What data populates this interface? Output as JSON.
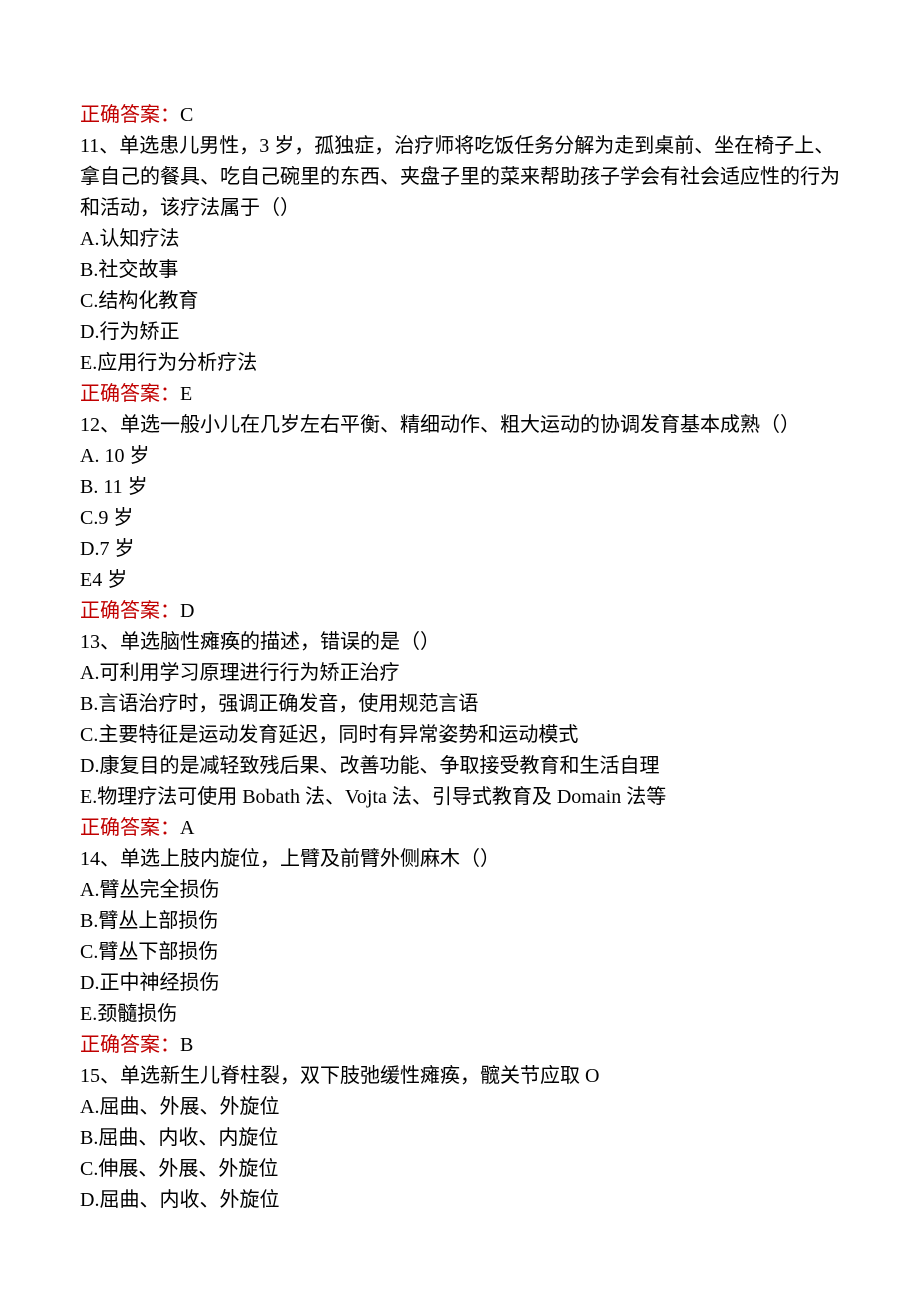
{
  "answer10": {
    "label": "正确答案：",
    "value": "C"
  },
  "q11": {
    "stem": "11、单选患儿男性，3 岁，孤独症，治疗师将吃饭任务分解为走到桌前、坐在椅子上、拿自己的餐具、吃自己碗里的东西、夹盘子里的菜来帮助孩子学会有社会适应性的行为和活动，该疗法属于（）",
    "optA": "A.认知疗法",
    "optB": "B.社交故事",
    "optC": "C.结构化教育",
    "optD": "D.行为矫正",
    "optE": "E.应用行为分析疗法",
    "answerLabel": "正确答案：",
    "answerValue": "E"
  },
  "q12": {
    "stem": "12、单选一般小儿在几岁左右平衡、精细动作、粗大运动的协调发育基本成熟（）",
    "optA": "A. 10 岁",
    "optB": "B. 11 岁",
    "optC": "C.9 岁",
    "optD": "D.7 岁",
    "optE": "E4 岁",
    "answerLabel": "正确答案：",
    "answerValue": "D"
  },
  "q13": {
    "stem": "13、单选脑性瘫痪的描述，错误的是（）",
    "optA": "A.可利用学习原理进行行为矫正治疗",
    "optB": "B.言语治疗时，强调正确发音，使用规范言语",
    "optC": "C.主要特征是运动发育延迟，同时有异常姿势和运动模式",
    "optD": "D.康复目的是减轻致残后果、改善功能、争取接受教育和生活自理",
    "optE": "E.物理疗法可使用 Bobath 法、Vojta 法、引导式教育及 Domain 法等",
    "answerLabel": "正确答案：",
    "answerValue": "A"
  },
  "q14": {
    "stem": "14、单选上肢内旋位，上臂及前臂外侧麻木（）",
    "optA": "A.臂丛完全损伤",
    "optB": "B.臂丛上部损伤",
    "optC": "C.臂丛下部损伤",
    "optD": "D.正中神经损伤",
    "optE": "E.颈髓损伤",
    "answerLabel": "正确答案：",
    "answerValue": "B"
  },
  "q15": {
    "stem": "15、单选新生儿脊柱裂，双下肢弛缓性瘫痪，髋关节应取 O",
    "optA": "A.屈曲、外展、外旋位",
    "optB": "B.屈曲、内收、内旋位",
    "optC": "C.伸展、外展、外旋位",
    "optD": "D.屈曲、内收、外旋位"
  }
}
